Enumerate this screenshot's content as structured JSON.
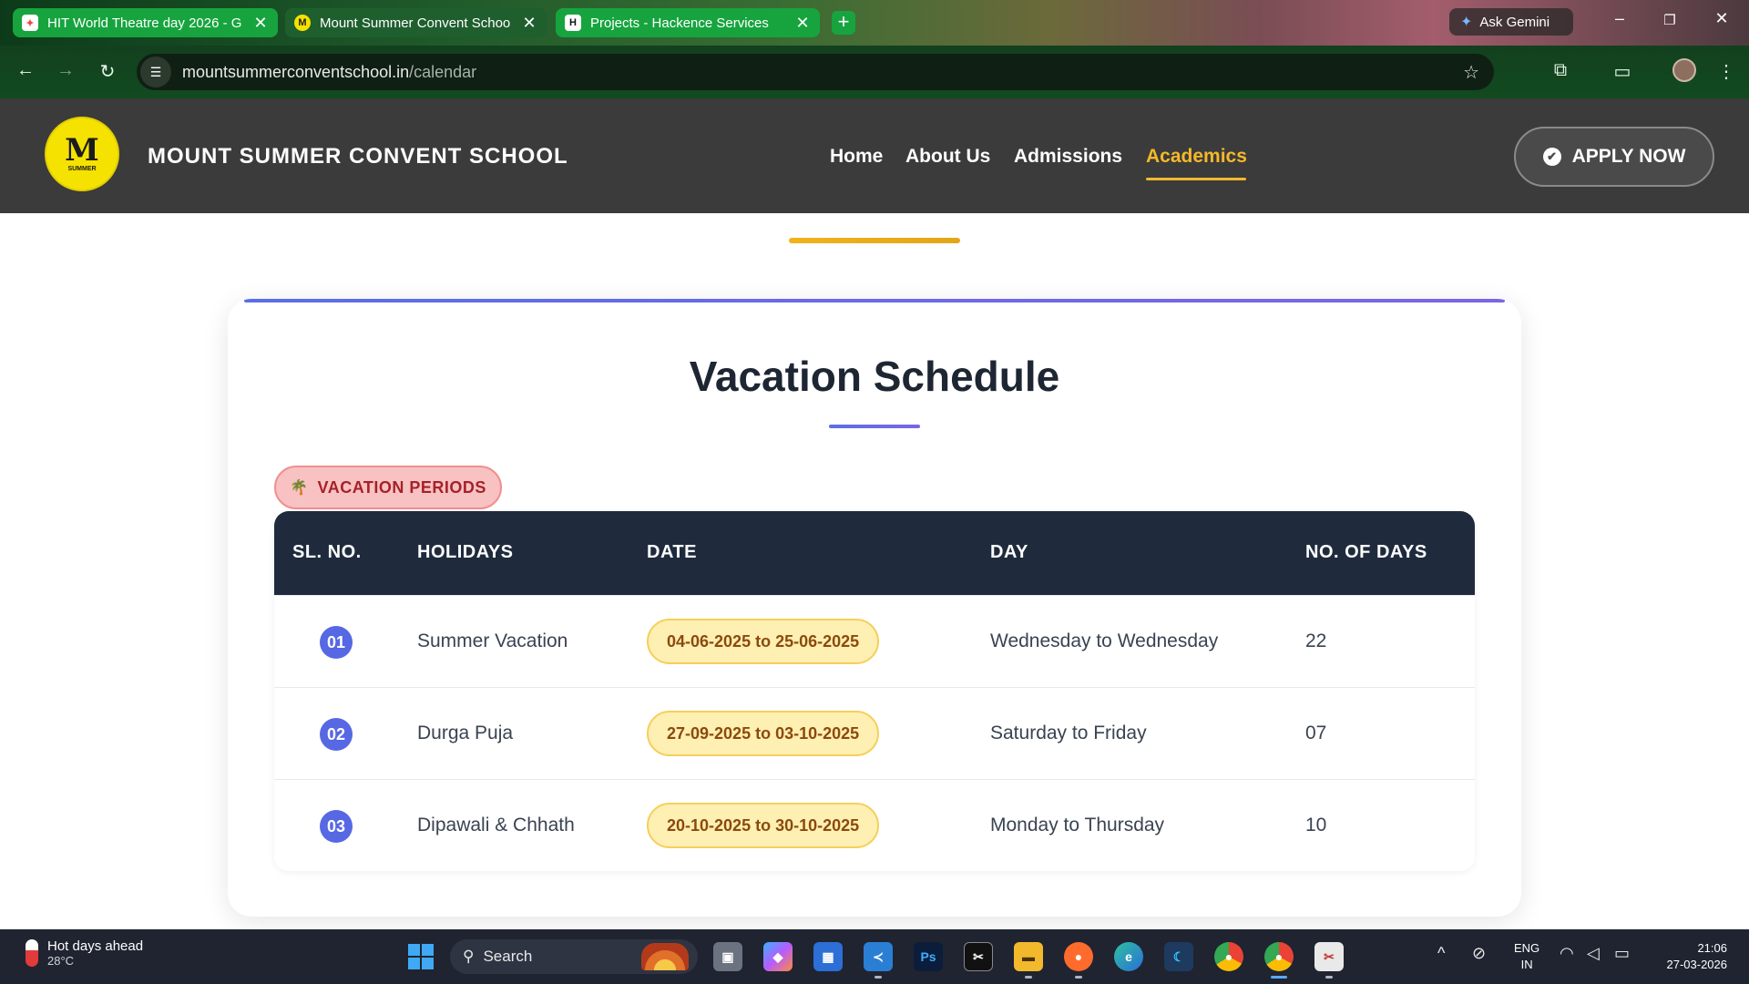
{
  "browser": {
    "tabs": [
      {
        "title": "HIT World Theatre day 2026 - G",
        "close": "✕"
      },
      {
        "title": "Mount Summer Convent Schoo",
        "close": "✕"
      },
      {
        "title": "Projects - Hackence Services",
        "close": "✕"
      }
    ],
    "new_tab": "+",
    "ask_gemini": "Ask Gemini",
    "url_domain": "mountsummerconventschool.in",
    "url_path": "/calendar"
  },
  "site": {
    "school_name": "MOUNT SUMMER CONVENT SCHOOL",
    "logo_letter": "M",
    "logo_text": "SUMMER",
    "nav": [
      "Home",
      "About Us",
      "Admissions",
      "Academics"
    ],
    "active_nav": "Academics",
    "apply_label": "APPLY NOW"
  },
  "schedule": {
    "title": "Vacation Schedule",
    "badge": "VACATION PERIODS",
    "columns": [
      "SL. NO.",
      "HOLIDAYS",
      "DATE",
      "DAY",
      "NO. OF DAYS"
    ],
    "rows": [
      {
        "sl": "01",
        "holiday": "Summer Vacation",
        "date": "04-06-2025 to 25-06-2025",
        "day": "Wednesday to Wednesday",
        "days": "22"
      },
      {
        "sl": "02",
        "holiday": "Durga Puja",
        "date": "27-09-2025 to 03-10-2025",
        "day": "Saturday to Friday",
        "days": "07"
      },
      {
        "sl": "03",
        "holiday": "Dipawali & Chhath",
        "date": "20-10-2025 to 30-10-2025",
        "day": "Monday to Thursday",
        "days": "10"
      }
    ]
  },
  "taskbar": {
    "weather_title": "Hot days ahead",
    "weather_temp": "28°C",
    "search_label": "Search",
    "lang_top": "ENG",
    "lang_bottom": "IN",
    "time": "21:06",
    "date": "27-03-2026"
  },
  "colors": {
    "header_bg": "#3b3b3b",
    "accent_gold": "#f5b82a",
    "table_header": "#1f2b3d",
    "number_badge": "#5668e3",
    "date_pill": "#feefb3",
    "tab_green": "#17a43f"
  },
  "icons": [
    "back-arrow-icon",
    "forward-arrow-icon",
    "reload-icon",
    "site-settings-icon",
    "bookmark-star-icon",
    "extensions-icon",
    "windows-start-icon",
    "search-icon",
    "check-circle-icon",
    "palm-tree-icon"
  ]
}
